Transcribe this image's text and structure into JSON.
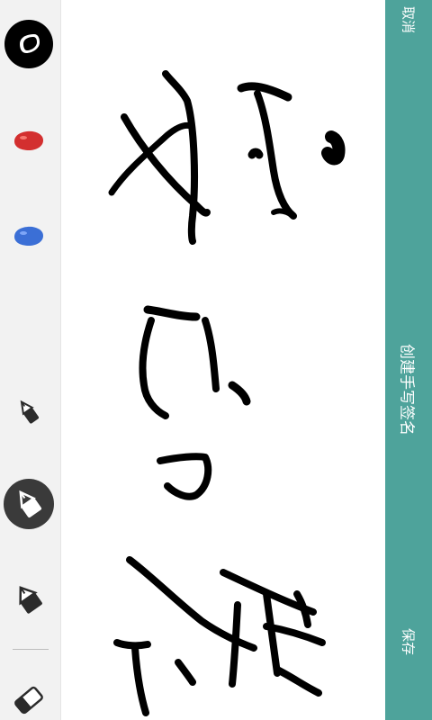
{
  "header": {
    "title": "创建手写签名",
    "cancel_label": "取消",
    "save_label": "保存",
    "bar_color": "#4ea39b"
  },
  "toolbar": {
    "colors": [
      {
        "name": "black-ink-icon",
        "color": "#000000",
        "selected": true
      },
      {
        "name": "red-ink-icon",
        "color": "#d32f2f",
        "selected": false
      },
      {
        "name": "blue-ink-icon",
        "color": "#3b6fd6",
        "selected": false
      }
    ],
    "pens": [
      {
        "name": "thin-pen-icon",
        "selected": false
      },
      {
        "name": "medium-pen-icon",
        "selected": true
      },
      {
        "name": "thick-pen-icon",
        "selected": false
      }
    ],
    "eraser": {
      "name": "eraser-icon"
    }
  }
}
